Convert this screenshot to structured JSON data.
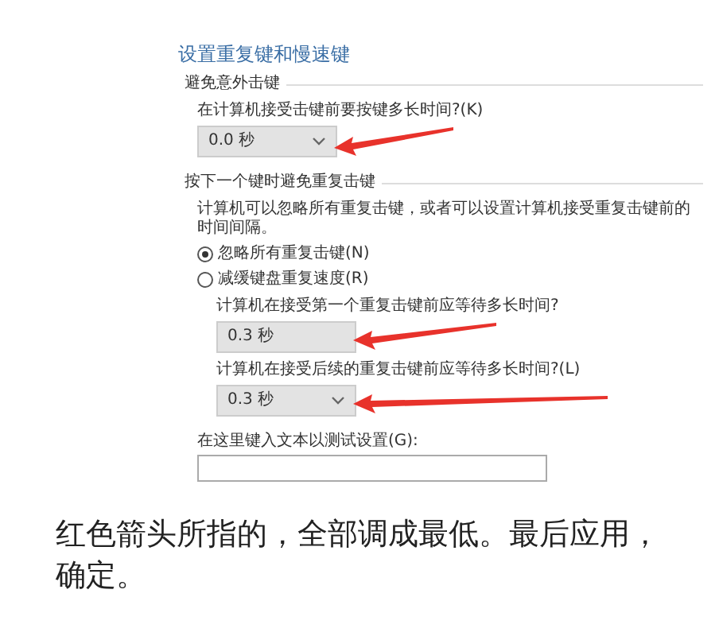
{
  "title": "设置重复键和慢速键",
  "bounce_group": {
    "legend": "避免意外击键",
    "prompt": "在计算机接受击键前要按键多长时间?(K)",
    "dropdown": {
      "value": "0.0 秒",
      "chevron": true,
      "arrow": true
    }
  },
  "repeat_group": {
    "legend": "按下一个键时避免重复击键",
    "description": "计算机可以忽略所有重复击键，或者可以设置计算机接受重复击键前的时间间隔。",
    "options": [
      {
        "label": "忽略所有重复击键(N)",
        "selected": true
      },
      {
        "label": "减缓键盘重复速度(R)",
        "selected": false
      }
    ],
    "settings": [
      {
        "prompt": "计算机在接受第一个重复击键前应等待多长时间?",
        "value": "0.3 秒",
        "chevron": false,
        "arrow": true
      },
      {
        "prompt": "计算机在接受后续的重复击键前应等待多长时间?(L)",
        "value": "0.3 秒",
        "chevron": true,
        "arrow": true
      }
    ]
  },
  "test": {
    "label": "在这里键入文本以测试设置(G):"
  },
  "caption": "红色箭头所指的，全部调成最低。最后应用，确定。"
}
